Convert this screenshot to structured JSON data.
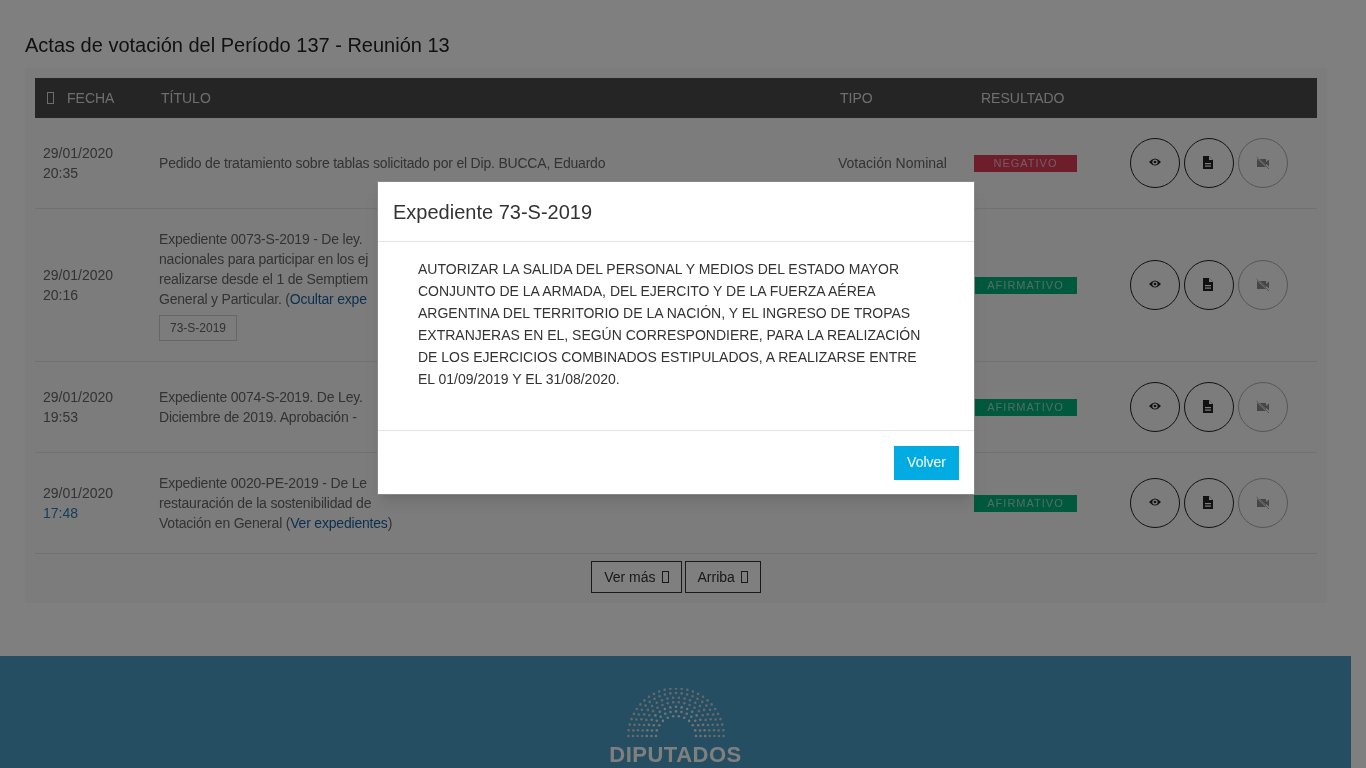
{
  "page_title": "Actas de votación del Período 137 - Reunión 13",
  "table": {
    "columns": [
      "FECHA",
      "TÍTULO",
      "TIPO",
      "RESULTADO"
    ],
    "rows": [
      {
        "date": "29/01/2020",
        "time": "20:35",
        "time_highlighted": false,
        "title_lines": [
          {
            "text": "Pedido de tratamiento sobre tablas solicitado por el Dip. BUCCA, Eduardo"
          }
        ],
        "tipo": "Votación Nominal",
        "result": {
          "label": "NEGATIVO",
          "kind": "negative"
        },
        "video_disabled": true
      },
      {
        "date": "29/01/2020",
        "time": "20:16",
        "time_highlighted": false,
        "title_lines": [
          {
            "text": "Expediente 0073-S-2019 - De ley."
          },
          {
            "text": "nacionales para participar en los ej"
          },
          {
            "text": "realizarse desde el 1 de Semptiem"
          },
          {
            "text": "General y Particular. (",
            "link": "Ocultar expe"
          }
        ],
        "tags": [
          "73-S-2019"
        ],
        "result": {
          "label": "AFIRMATIVO",
          "kind": "positive"
        },
        "video_disabled": true
      },
      {
        "date": "29/01/2020",
        "time": "19:53",
        "time_highlighted": false,
        "title_lines": [
          {
            "text": "Expediente 0074-S-2019. De Ley."
          },
          {
            "text": "Diciembre de 2019. Aprobación -"
          }
        ],
        "result": {
          "label": "AFIRMATIVO",
          "kind": "positive"
        },
        "video_disabled": true
      },
      {
        "date": "29/01/2020",
        "time": "17:48",
        "time_highlighted": true,
        "title_lines": [
          {
            "text": "Expediente 0020-PE-2019 - De Le"
          },
          {
            "text": "restauración de la sostenibilidad de"
          },
          {
            "text": "Votación en General (",
            "link": "Ver expedientes",
            "after": ")"
          }
        ],
        "result": {
          "label": "AFIRMATIVO",
          "kind": "positive"
        },
        "video_disabled": true
      }
    ]
  },
  "pager": [
    "Ver más",
    "Arriba"
  ],
  "modal": {
    "title": "Expediente 73-S-2019",
    "body": "AUTORIZAR LA SALIDA DEL PERSONAL Y MEDIOS DEL ESTADO MAYOR CONJUNTO DE LA ARMADA, DEL EJERCITO Y DE LA FUERZA AÉREA ARGENTINA DEL TERRITORIO DE LA NACIÓN, Y EL INGRESO DE TROPAS EXTRANJERAS EN EL, SEGÚN CORRESPONDIERE, PARA LA REALIZACIÓN DE LOS EJERCICIOS COMBINADOS ESTIPULADOS, A REALIZARSE ENTRE EL 01/09/2019 Y EL 31/08/2020.",
    "button": "Volver"
  },
  "footer": {
    "logo_text": "DIPUTADOS"
  }
}
